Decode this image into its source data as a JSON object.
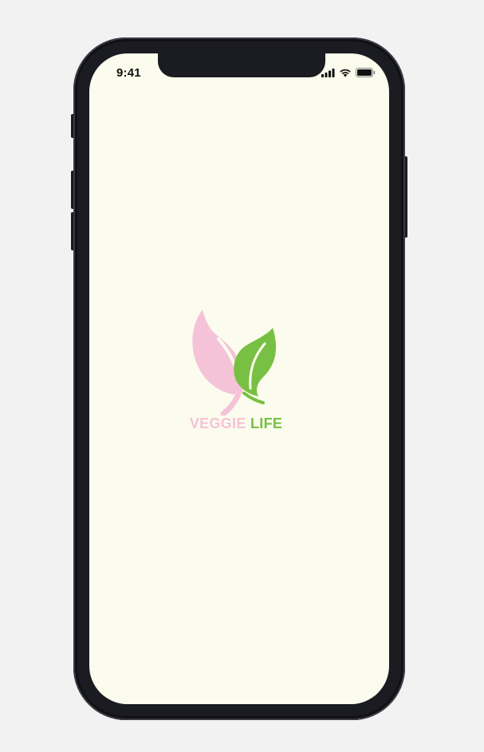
{
  "status_bar": {
    "time": "9:41",
    "icons": [
      "cellular-signal-icon",
      "wifi-icon",
      "battery-icon"
    ]
  },
  "splash": {
    "brand_word_1": "VEGGIE",
    "brand_word_2": "LIFE",
    "logo_icon": "leaf-logo-icon"
  },
  "colors": {
    "screen_background": "#fbfced",
    "brand_pink": "#f5c3d8",
    "brand_green": "#78c043",
    "device_frame": "#1b1b22",
    "page_background": "#f2f2f2"
  }
}
